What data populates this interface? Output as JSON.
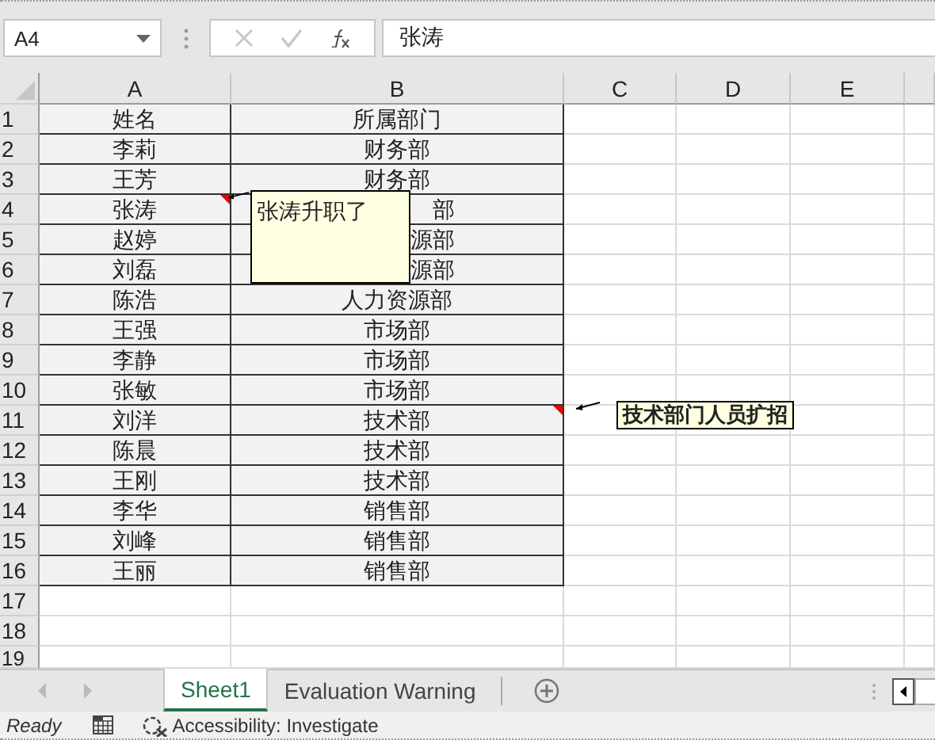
{
  "formula_bar": {
    "name_box": "A4",
    "formula": "张涛"
  },
  "columns": [
    "A",
    "B",
    "C",
    "D",
    "E"
  ],
  "rows": [
    {
      "number": "1",
      "cells": [
        {
          "text": "姓名"
        },
        {
          "text": "所属部门"
        }
      ]
    },
    {
      "number": "2",
      "cells": [
        {
          "text": "李莉"
        },
        {
          "text": "财务部"
        }
      ]
    },
    {
      "number": "3",
      "cells": [
        {
          "text": "王芳"
        },
        {
          "text": "财务部"
        }
      ]
    },
    {
      "number": "4",
      "cells": [
        {
          "text": "张涛",
          "comment": {
            "text": "张涛升职了",
            "bold": false
          }
        },
        {
          "text": "部",
          "covered": true
        }
      ]
    },
    {
      "number": "5",
      "cells": [
        {
          "text": "赵婷"
        },
        {
          "text": "源部",
          "covered": true
        }
      ]
    },
    {
      "number": "6",
      "cells": [
        {
          "text": "刘磊"
        },
        {
          "text": "源部",
          "covered": true
        }
      ]
    },
    {
      "number": "7",
      "cells": [
        {
          "text": "陈浩"
        },
        {
          "text": "人力资源部"
        }
      ]
    },
    {
      "number": "8",
      "cells": [
        {
          "text": "王强"
        },
        {
          "text": "市场部"
        }
      ]
    },
    {
      "number": "9",
      "cells": [
        {
          "text": "李静"
        },
        {
          "text": "市场部"
        }
      ]
    },
    {
      "number": "10",
      "cells": [
        {
          "text": "张敏"
        },
        {
          "text": "市场部"
        }
      ]
    },
    {
      "number": "11",
      "cells": [
        {
          "text": "刘洋"
        },
        {
          "text": "技术部",
          "comment": {
            "text": "技术部门人员扩招",
            "bold": true
          }
        }
      ]
    },
    {
      "number": "12",
      "cells": [
        {
          "text": "陈晨"
        },
        {
          "text": "技术部"
        }
      ]
    },
    {
      "number": "13",
      "cells": [
        {
          "text": "王刚"
        },
        {
          "text": "技术部"
        }
      ]
    },
    {
      "number": "14",
      "cells": [
        {
          "text": "李华"
        },
        {
          "text": "销售部"
        }
      ]
    },
    {
      "number": "15",
      "cells": [
        {
          "text": "刘峰"
        },
        {
          "text": "销售部"
        }
      ]
    },
    {
      "number": "16",
      "cells": [
        {
          "text": "王丽"
        },
        {
          "text": "销售部"
        }
      ]
    },
    {
      "number": "17"
    },
    {
      "number": "18"
    },
    {
      "number": "19"
    }
  ],
  "sheet_tabs": [
    {
      "label": "Sheet1",
      "selected": true
    },
    {
      "label": "Evaluation Warning",
      "selected": false
    }
  ],
  "status_bar": {
    "mode": "Ready",
    "accessibility": "Accessibility: Investigate"
  }
}
